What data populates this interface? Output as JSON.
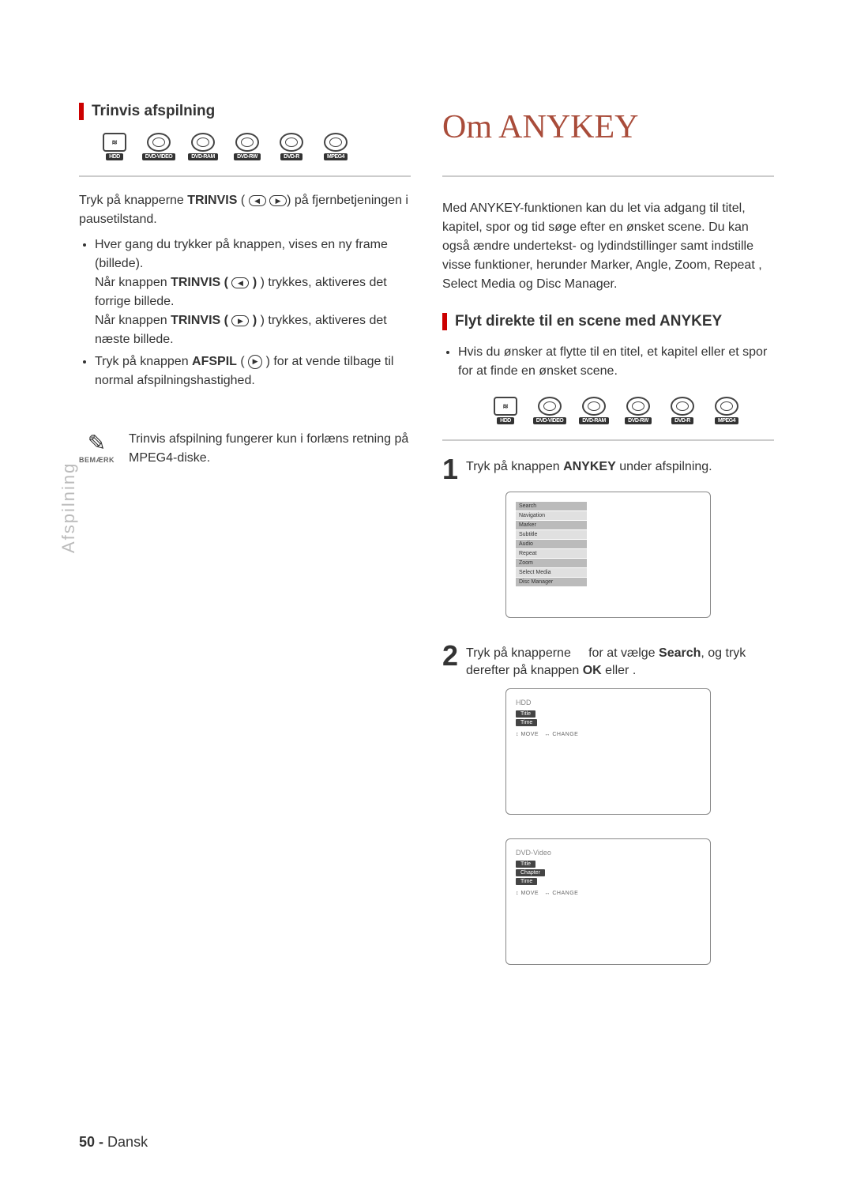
{
  "left": {
    "section_title": "Trinvis afspilning",
    "discs": [
      "HDD",
      "DVD-VIDEO",
      "DVD-RAM",
      "DVD-RW",
      "DVD-R",
      "MPEG4"
    ],
    "intro_a": "Tryk på knapperne ",
    "intro_bold": "TRINVIS",
    "intro_b": " (",
    "intro_c": ") på fjernbetjeningen i pausetilstand.",
    "b1a": "Hver gang du trykker på knappen, vises en ny frame (billede).",
    "b1b_a": "Når knappen ",
    "b1b_bold": "TRINVIS ( ",
    "b1b_b": " ) trykkes, aktiveres det forrige billede.",
    "b1c_a": "Når knappen ",
    "b1c_bold": "TRINVIS ( ",
    "b1c_b": " ) trykkes, aktiveres det næste billede.",
    "b2_a": "Tryk på knappen ",
    "b2_bold": "AFSPIL",
    "b2_b": " ( ",
    "b2_c": " ) for at vende tilbage til normal afspilningshastighed.",
    "note_label": "BEMÆRK",
    "note_text": "Trinvis afspilning fungerer kun i forlæns retning på MPEG4-diske.",
    "side_label": "Afspilning"
  },
  "right": {
    "big_title": "Om ANYKEY",
    "intro": "Med ANYKEY-funktionen kan du let via adgang til titel, kapitel, spor og tid søge efter en ønsket scene. Du kan også ændre undertekst- og lydindstillinger samt indstille visse funktioner, herunder Marker, Angle, Zoom, Repeat , Select Media og Disc Manager.",
    "section_title": "Flyt direkte til en scene med ANYKEY",
    "bullet": "Hvis du ønsker at flytte til en titel, et kapitel eller et spor for at finde en ønsket scene.",
    "discs": [
      "HDD",
      "DVD-VIDEO",
      "DVD-RAM",
      "DVD-RW",
      "DVD-R",
      "MPEG4"
    ],
    "step1_a": "Tryk på knappen ",
    "step1_bold": "ANYKEY",
    "step1_b": " under afspilning.",
    "menu": [
      "Search",
      "Navigation",
      "Marker",
      "Subtitle",
      "Audio",
      "Repeat",
      "Zoom",
      "Select Media",
      "Disc Manager"
    ],
    "step2_a": "Tryk på knapperne",
    "step2_mid": "for at vælge ",
    "step2_bold": "Search",
    "step2_b": ", og tryk derefter på knappen ",
    "step2_ok": "OK",
    "step2_c": " eller   .",
    "hdd_label": "HDD",
    "hdd_items": [
      "Title",
      "Time"
    ],
    "dvd_label": "DVD-Video",
    "dvd_items": [
      "Title",
      "Chapter",
      "Time"
    ],
    "hint_move": "MOVE",
    "hint_change": "CHANGE"
  },
  "footer": {
    "page": "50 -",
    "lang": "Dansk"
  }
}
